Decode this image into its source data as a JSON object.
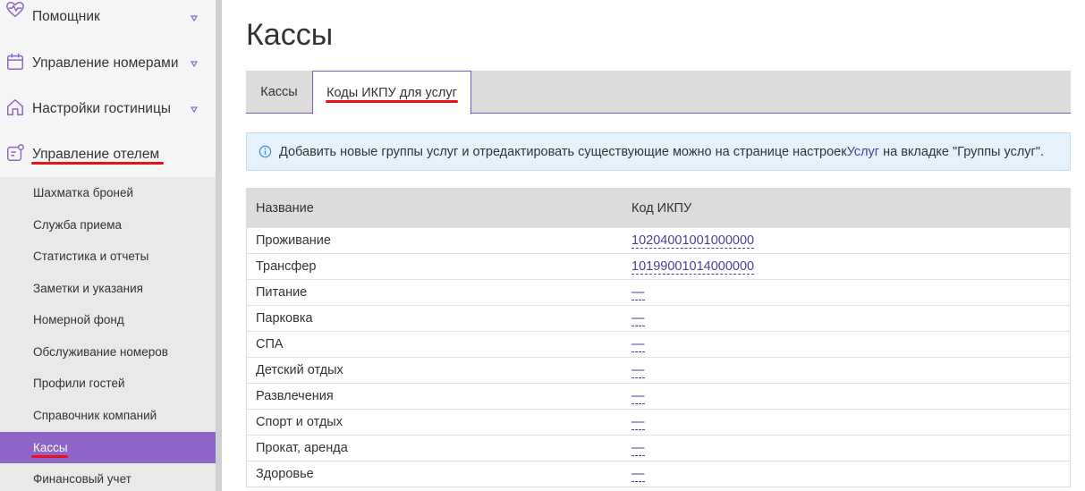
{
  "sidebar": {
    "items": [
      {
        "label": "Помощник",
        "icon": "heart-pulse-icon"
      },
      {
        "label": "Управление номерами",
        "icon": "calendar-icon"
      },
      {
        "label": "Настройки гостиницы",
        "icon": "home-icon"
      },
      {
        "label": "Управление отелем",
        "icon": "hotel-settings-icon"
      }
    ],
    "subitems": [
      "Шахматка броней",
      "Служба приема",
      "Статистика и отчеты",
      "Заметки и указания",
      "Номерной фонд",
      "Обслуживание номеров",
      "Профили гостей",
      "Справочник компаний",
      "Кассы",
      "Финансовый учет"
    ],
    "active_subitem": "Кассы"
  },
  "page": {
    "title": "Кассы",
    "tabs": [
      "Кассы",
      "Коды ИКПУ для услуг"
    ],
    "active_tab": "Коды ИКПУ для услуг"
  },
  "info": {
    "text_before": "Добавить новые группы услуг и отредактировать существующие можно на странице настроек ",
    "link": "Услуг",
    "text_after": " на вкладке \"Группы услуг\"."
  },
  "table": {
    "headers": [
      "Название",
      "Код ИКПУ"
    ],
    "rows": [
      {
        "name": "Проживание",
        "code": "10204001001000000"
      },
      {
        "name": "Трансфер",
        "code": "10199001014000000"
      },
      {
        "name": "Питание",
        "code": "—"
      },
      {
        "name": "Парковка",
        "code": "—"
      },
      {
        "name": "СПА",
        "code": "—"
      },
      {
        "name": "Детский отдых",
        "code": "—"
      },
      {
        "name": "Развлечения",
        "code": "—"
      },
      {
        "name": "Спорт и отдых",
        "code": "—"
      },
      {
        "name": "Прокат, аренда",
        "code": "—"
      },
      {
        "name": "Здоровье",
        "code": "—"
      }
    ]
  },
  "colors": {
    "accent": "#8e65c6",
    "link": "#4a3d9c",
    "annotation": "#e8121a"
  }
}
